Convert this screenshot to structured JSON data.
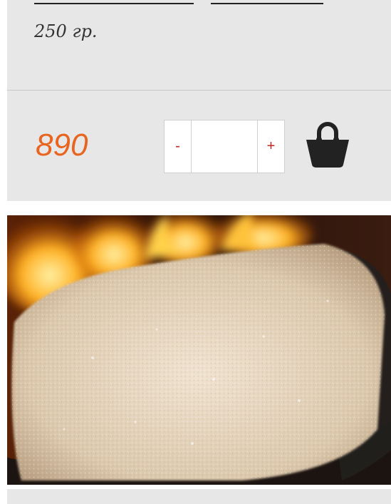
{
  "product": {
    "weight_label": "250 гр.",
    "price": "890"
  },
  "quantity_stepper": {
    "minus_label": "-",
    "plus_label": "+",
    "value": ""
  },
  "icons": {
    "cart": "shopping-bag-icon"
  },
  "colors": {
    "price": "#e8641f",
    "stepper_symbols": "#c0271d",
    "card_background": "#e7e7e7",
    "cart_icon": "#222222"
  }
}
